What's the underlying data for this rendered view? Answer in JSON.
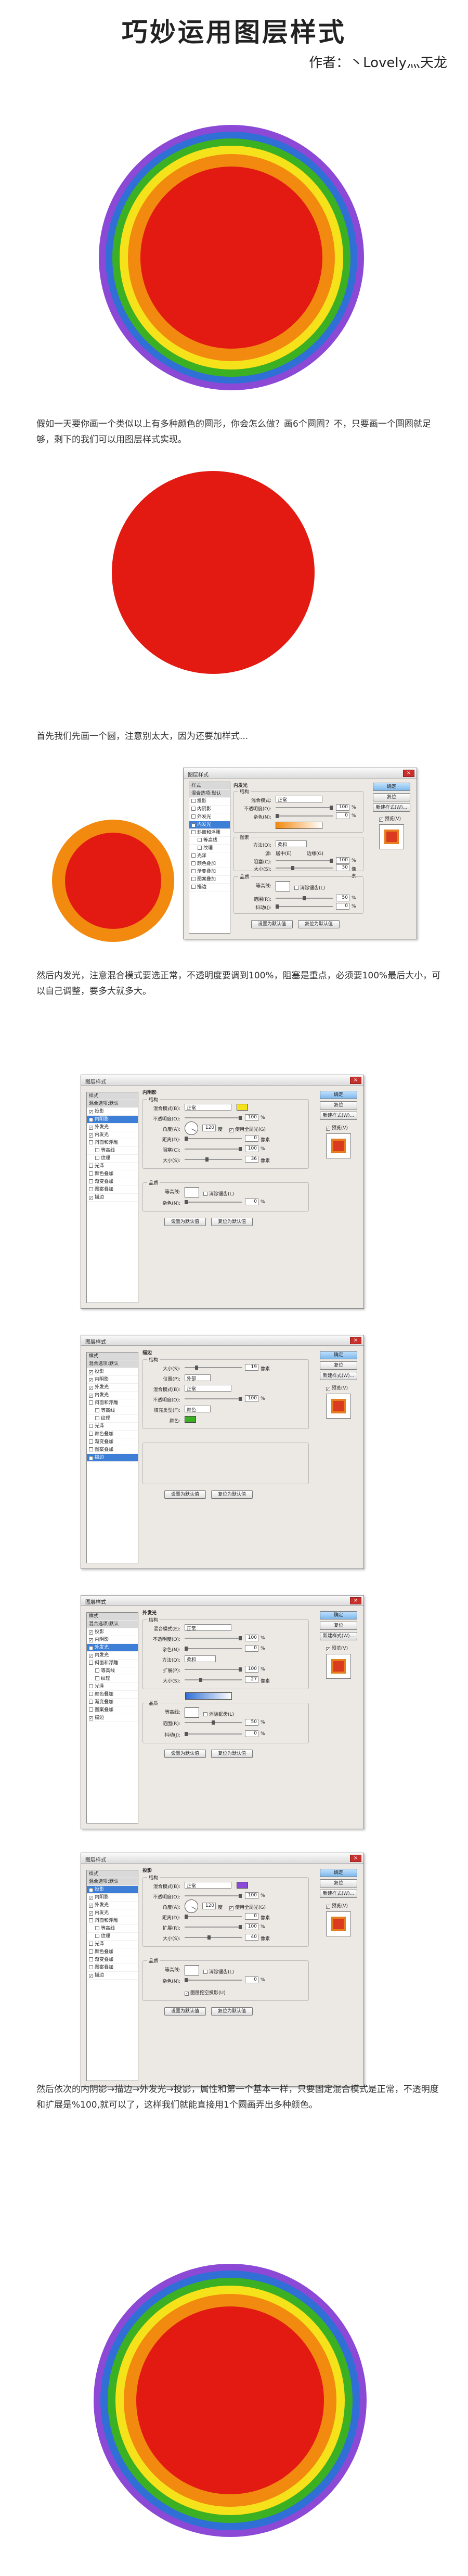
{
  "page": {
    "title": "巧妙运用图层样式",
    "author": "作者：丶Lovely灬天龙"
  },
  "paragraphs": {
    "p1": "假如一天要你画一个类似以上有多种颜色的圆形，你会怎么做？画6个圆圈？不，只要画一个圆圈就足够，剩下的我们可以用图层样式实现。",
    "p2": "首先我们先画一个圆，注意别太大，因为还要加样式...",
    "p3": "然后内发光，注意混合模式要选正常，不透明度要调到100%，阻塞是重点，必须要100%最后大小，可以自己调整，要多大就多大。",
    "p4": "然后依次的内阴影→描边→外发光→投影，属性和第一个基本一样，只要固定混合模式是正常，不透明度和扩展是%100,就可以了，这样我们就能直接用1个圆画弄出多种颜色。"
  },
  "colors": {
    "purple": "#8c49d6",
    "blue": "#2f6fd6",
    "green": "#3bb022",
    "yellow": "#f6e21a",
    "orange": "#f28a10",
    "red": "#e21a12"
  },
  "dialog": {
    "title": "图层样式",
    "close": "×",
    "sidebar": [
      {
        "label": "样式",
        "kind": "hdr"
      },
      {
        "label": "混合选项:默认",
        "kind": "hdr"
      },
      {
        "label": "投影",
        "kind": "item"
      },
      {
        "label": "内阴影",
        "kind": "item"
      },
      {
        "label": "外发光",
        "kind": "item"
      },
      {
        "label": "内发光",
        "kind": "item"
      },
      {
        "label": "斜面和浮雕",
        "kind": "item"
      },
      {
        "label": "等高线",
        "kind": "sub"
      },
      {
        "label": "纹理",
        "kind": "sub"
      },
      {
        "label": "光泽",
        "kind": "item"
      },
      {
        "label": "颜色叠加",
        "kind": "item"
      },
      {
        "label": "渐变叠加",
        "kind": "item"
      },
      {
        "label": "图案叠加",
        "kind": "item"
      },
      {
        "label": "描边",
        "kind": "item"
      }
    ],
    "ok": "确定",
    "cancel": "复位",
    "new_style": "新建样式(W)...",
    "preview": "预览(V)",
    "set_default": "设置为默认值",
    "reset_default": "复位为默认值"
  },
  "d1": {
    "section": "内发光",
    "structure": "结构",
    "blend_label": "混合模式:",
    "blend_value": "正常",
    "opacity_label": "不透明度(O):",
    "opacity_value": "100",
    "noise_label": "杂色(N):",
    "noise_value": "0",
    "elements": "图素",
    "method_label": "方法(Q):",
    "method_value": "柔和",
    "source_label": "源:",
    "source_a": "居中(E)",
    "source_b": "边缘(G)",
    "choke_label": "阻塞(C):",
    "choke_value": "100",
    "size_label": "大小(S):",
    "size_value": "30",
    "quality": "品质",
    "contour_label": "等高线:",
    "antialias": "消除锯齿(L)",
    "range_label": "范围(R):",
    "range_value": "50",
    "jitter_label": "抖动(J):",
    "jitter_value": "0",
    "unit_pct": "%",
    "unit_px": "像素"
  },
  "d2": {
    "section": "内阴影",
    "structure": "结构",
    "blend_label": "混合模式(B):",
    "blend_value": "正常",
    "opacity_label": "不透明度(O):",
    "opacity_value": "100",
    "angle_label": "角度(A):",
    "angle_value": "120",
    "global_light": "使用全局光(G)",
    "distance_label": "距离(D):",
    "distance_value": "0",
    "choke_label": "阻塞(C):",
    "choke_value": "100",
    "size_label": "大小(S):",
    "size_value": "36",
    "quality": "品质",
    "contour_label": "等高线:",
    "antialias": "消除锯齿(L)",
    "noise_label": "杂色(N):",
    "noise_value": "0",
    "unit_pct": "%",
    "unit_px": "像素",
    "unit_deg": "度"
  },
  "d3": {
    "section": "描边",
    "structure": "结构",
    "size_label": "大小(S):",
    "size_value": "19",
    "position_label": "位置(P):",
    "position_value": "外部",
    "blend_label": "混合模式(B):",
    "blend_value": "正常",
    "opacity_label": "不透明度(O):",
    "opacity_value": "100",
    "fill_label": "填充类型(F):",
    "fill_value": "颜色",
    "color_label": "颜色:",
    "unit_pct": "%",
    "unit_px": "像素"
  },
  "d4": {
    "section": "外发光",
    "structure": "结构",
    "blend_label": "混合模式(E):",
    "blend_value": "正常",
    "opacity_label": "不透明度(O):",
    "opacity_value": "100",
    "noise_label": "杂色(N):",
    "noise_value": "0",
    "elements": "图素",
    "method_label": "方法(Q):",
    "method_value": "柔和",
    "spread_label": "扩展(P):",
    "spread_value": "100",
    "size_label": "大小(S):",
    "size_value": "27",
    "quality": "品质",
    "contour_label": "等高线:",
    "antialias": "消除锯齿(L)",
    "range_label": "范围(R):",
    "range_value": "50",
    "jitter_label": "抖动(J):",
    "jitter_value": "0",
    "unit_pct": "%",
    "unit_px": "像素"
  },
  "d5": {
    "section": "投影",
    "structure": "结构",
    "blend_label": "混合模式(B):",
    "blend_value": "正常",
    "opacity_label": "不透明度(O):",
    "opacity_value": "100",
    "angle_label": "角度(A):",
    "angle_value": "120",
    "global_light": "使用全局光(G)",
    "distance_label": "距离(D):",
    "distance_value": "0",
    "spread_label": "扩展(R):",
    "spread_value": "100",
    "size_label": "大小(S):",
    "size_value": "40",
    "quality": "品质",
    "contour_label": "等高线:",
    "antialias": "消除锯齿(L)",
    "noise_label": "杂色(N):",
    "noise_value": "0",
    "knockout": "图层挖空投影(U)",
    "unit_pct": "%",
    "unit_px": "像素",
    "unit_deg": "度"
  }
}
